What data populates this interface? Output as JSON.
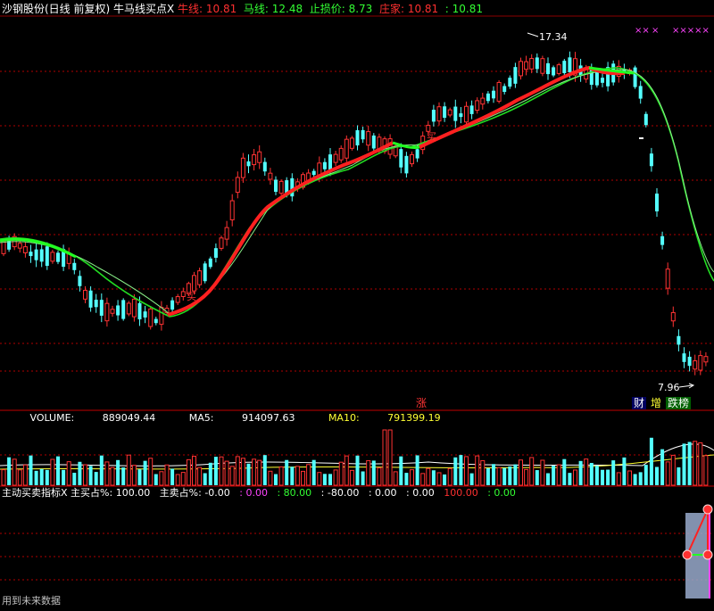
{
  "header": {
    "stock": "沙钢股份(日线 前复权)",
    "indicator": "牛马线买点X",
    "items": [
      {
        "label": "牛线:",
        "value": "10.81",
        "color": "#ff3030"
      },
      {
        "label": "马线:",
        "value": "12.48",
        "color": "#33ff33"
      },
      {
        "label": "止损价:",
        "value": "8.73",
        "color": "#33ff33"
      },
      {
        "label": "庄家:",
        "value": "10.81",
        "color": "#ff3030"
      },
      {
        "label": ":",
        "value": "10.81",
        "color": "#33ff33"
      }
    ]
  },
  "main": {
    "max_price_label": "17.34",
    "min_price_label": "7.96",
    "buy_marks": [
      "买",
      "买"
    ],
    "x_marks": [
      "××",
      "×",
      "×××××"
    ],
    "event_badges": [
      "涨",
      "财",
      "增",
      "跌榜"
    ]
  },
  "volume": {
    "label": "VOLUME:",
    "value": "889049.44",
    "ma5_label": "MA5:",
    "ma5": "914097.63",
    "ma10_label": "MA10:",
    "ma10": "791399.19"
  },
  "indicator2": {
    "name": "主动买卖指标X",
    "items": [
      {
        "text": "主买占%: 100.00",
        "color": "#ffffff"
      },
      {
        "text": "主卖占%: -0.00",
        "color": "#ffffff"
      },
      {
        "text": ": 0.00",
        "color": "#ff44ff"
      },
      {
        "text": ": 80.00",
        "color": "#33ff33"
      },
      {
        "text": ": -80.00",
        "color": "#ffffff"
      },
      {
        "text": ": 0.00",
        "color": "#ffffff"
      },
      {
        "text": ": 0.00",
        "color": "#ffffff"
      },
      {
        "text": "100.00",
        "color": "#ff3030"
      },
      {
        "text": ": 0.00",
        "color": "#33ff33"
      }
    ]
  },
  "footer_note": "用到未来数据",
  "colors": {
    "up": "#ff3333",
    "down": "#54ffff",
    "bull": "#ff2020",
    "horse": "#22dd22",
    "grid": "#b00000"
  }
}
